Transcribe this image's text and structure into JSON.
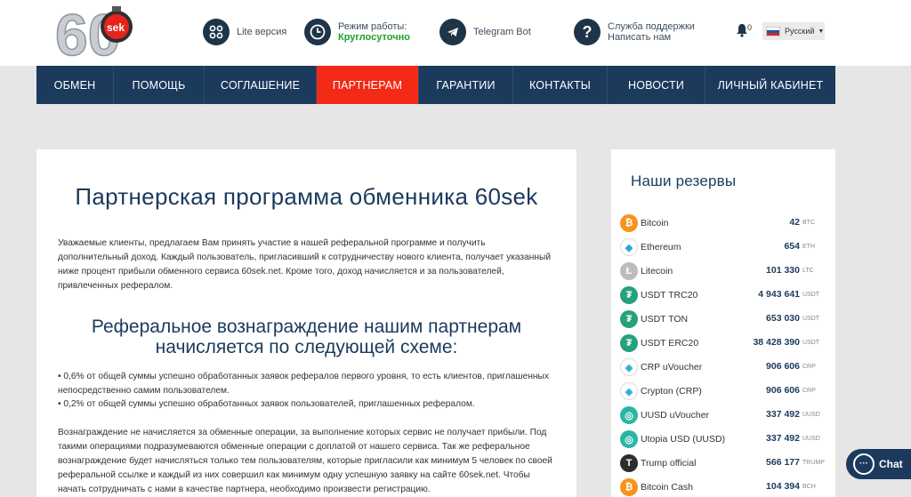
{
  "header": {
    "logo_text": "60sek",
    "lite": "Lite версия",
    "work_label": "Режим работы:",
    "work_value": "Круглосуточно",
    "telegram": "Telegram Bot",
    "support_1": "Служба поддержки",
    "support_2": "Написать нам",
    "notifications": "0",
    "language": "Русский"
  },
  "nav": [
    {
      "label": "ОБМЕН"
    },
    {
      "label": "ПОМОЩЬ"
    },
    {
      "label": "СОГЛАШЕНИЕ"
    },
    {
      "label": "ПАРТНЕРАМ"
    },
    {
      "label": "ГАРАНТИИ"
    },
    {
      "label": "КОНТАКТЫ"
    },
    {
      "label": "НОВОСТИ"
    },
    {
      "label": "ЛИЧНЫЙ КАБИНЕТ"
    }
  ],
  "main": {
    "title": "Партнерская программа обменника 60sek",
    "intro": "Уважаемые клиенты, предлагаем Вам принять участие в нашей реферальной программе и получить дополнительный доход. Каждый пользователь, пригласивший к сотрудничеству нового клиента, получает указанный ниже процент прибыли обменного сервиса 60sek.net. Кроме того, доход начисляется и за пользователей, привлеченных рефералом.",
    "subtitle": "Реферальное вознаграждение нашим партнерам начисляется по следующей схеме:",
    "bullet1": "• 0,6% от общей суммы успешно обработанных заявок рефералов первого уровня, то есть клиентов, приглашенных непосредственно самим пользователем.",
    "bullet2": "• 0,2% от общей суммы успешно обработанных заявок пользователей, приглашенных рефералом.",
    "para2": "Вознаграждение не начисляется за обменные операции, за выполнение которых сервис не получает прибыли. Под такими операциями подразумеваются обменные операции с доплатой от нашего сервиса. Так же реферальное вознаграждение будет начисляться только тем пользователям, которые пригласили как минимум 5 человек по своей реферальной ссылке и каждый из них  совершил как минимум одну успешную заявку на сайте 60sek.net. Чтобы начать сотрудничать с нами в качестве партнера, необходимо произвести регистрацию."
  },
  "reserves": {
    "title": "Наши резервы",
    "items": [
      {
        "name": "Bitcoin",
        "amount": "42",
        "cur": "BTC",
        "icon": "bitcoin-icon",
        "color": "#f7931a",
        "glyph": "₿"
      },
      {
        "name": "Ethereum",
        "amount": "654",
        "cur": "ETH",
        "icon": "ethereum-icon",
        "color": "#ffffff",
        "glyph": "◆"
      },
      {
        "name": "Litecoin",
        "amount": "101 330",
        "cur": "LTC",
        "icon": "litecoin-icon",
        "color": "#bfbbbb",
        "glyph": "Ł"
      },
      {
        "name": "USDT TRC20",
        "amount": "4 943 641",
        "cur": "USDT",
        "icon": "tether-icon",
        "color": "#26a17b",
        "glyph": "₮"
      },
      {
        "name": "USDT TON",
        "amount": "653 030",
        "cur": "USDT",
        "icon": "tether-icon",
        "color": "#26a17b",
        "glyph": "₮"
      },
      {
        "name": "USDT ERC20",
        "amount": "38 428 390",
        "cur": "USDT",
        "icon": "tether-icon",
        "color": "#26a17b",
        "glyph": "₮"
      },
      {
        "name": "CRP uVoucher",
        "amount": "906 606",
        "cur": "CRP",
        "icon": "crypton-icon",
        "color": "#ffffff",
        "glyph": "◈"
      },
      {
        "name": "Crypton (CRP)",
        "amount": "906 606",
        "cur": "CRP",
        "icon": "crypton-icon",
        "color": "#ffffff",
        "glyph": "◈"
      },
      {
        "name": "UUSD uVoucher",
        "amount": "337 492",
        "cur": "UUSD",
        "icon": "utopia-icon",
        "color": "#2bb5a5",
        "glyph": "◎"
      },
      {
        "name": "Utopia USD (UUSD)",
        "amount": "337 492",
        "cur": "UUSD",
        "icon": "utopia-icon",
        "color": "#2bb5a5",
        "glyph": "◎"
      },
      {
        "name": "Trump official",
        "amount": "566 177",
        "cur": "TRUMP",
        "icon": "trump-icon",
        "color": "#2d2d2d",
        "glyph": "T"
      },
      {
        "name": "Bitcoin Cash",
        "amount": "104 394",
        "cur": "BCH",
        "icon": "bitcoin-cash-icon",
        "color": "#f7931a",
        "glyph": "₿"
      }
    ]
  },
  "chat_label": "Chat"
}
